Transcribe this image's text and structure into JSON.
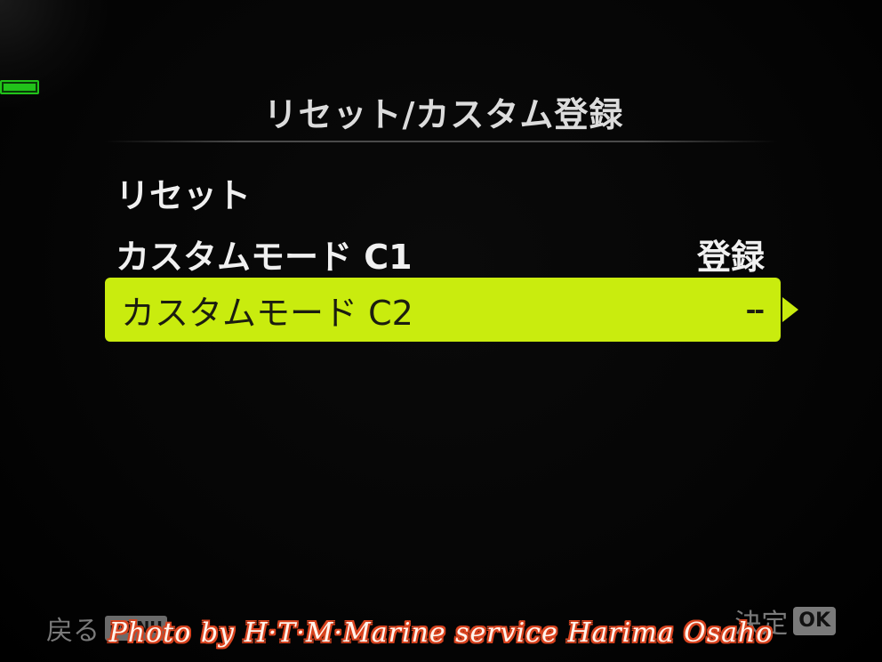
{
  "header": {
    "title": "リセット/カスタム登録"
  },
  "menu": {
    "items": [
      {
        "label": "リセット",
        "value": ""
      },
      {
        "label": "カスタムモード C1",
        "value": "登録"
      },
      {
        "label": "カスタムモード C2",
        "value": "--"
      }
    ],
    "selected_index": 2
  },
  "footer": {
    "back_label": "戻る",
    "back_key": "MENU",
    "ok_label": "決定",
    "ok_key": "OK"
  },
  "watermark": {
    "text": "Photo by H·T·M·Marine service Harima Osaho"
  },
  "colors": {
    "highlight": "#c9ec0e",
    "battery": "#21c21a",
    "watermark_outline": "#d8431f"
  },
  "icons": {
    "battery": "battery-icon",
    "submenu": "chevron-right-icon"
  }
}
